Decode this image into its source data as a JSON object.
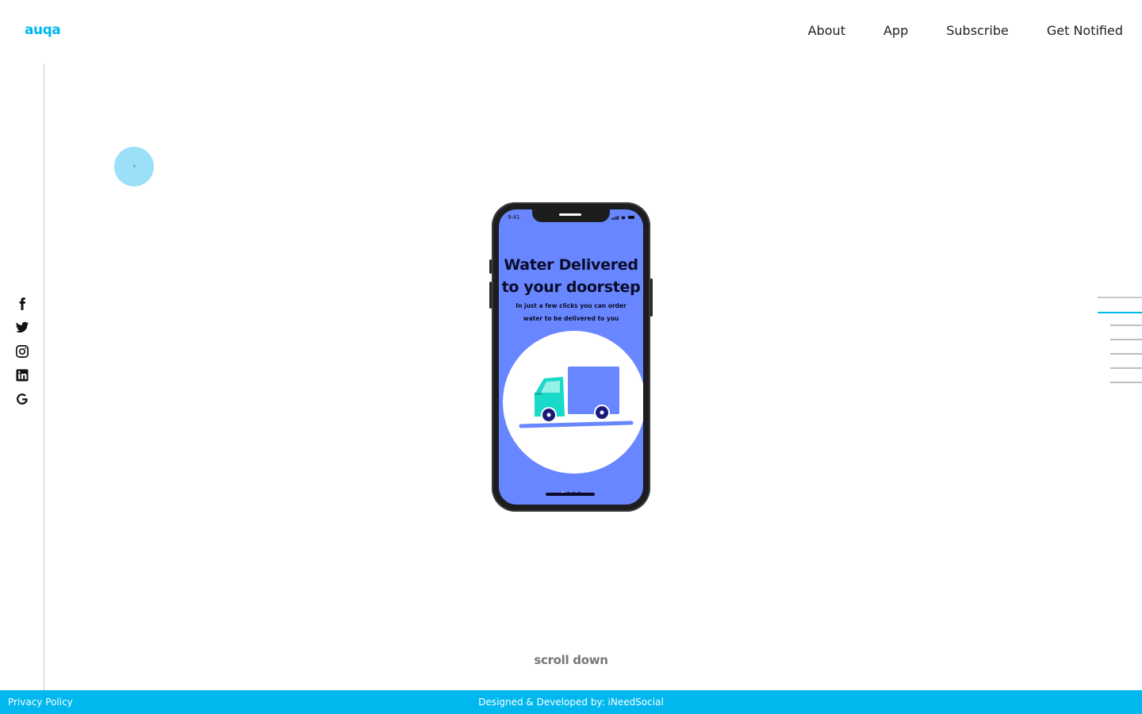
{
  "header": {
    "logo_text": "auqa",
    "nav": [
      "About",
      "App",
      "Subscribe",
      "Get Notified"
    ]
  },
  "social_icons": [
    "facebook-icon",
    "twitter-icon",
    "instagram-icon",
    "linkedin-icon",
    "google-icon"
  ],
  "phone": {
    "status_time": "9:41",
    "title_line1": "Water Delivered",
    "title_line2": "to your doorstep",
    "sub_line1": "In just a few clicks you can order",
    "sub_line2": "water to be delivered to you",
    "pager": {
      "total": 4,
      "active": 1
    }
  },
  "scroll_hint": "scroll down",
  "section_indicators": {
    "total": 7,
    "active": 2
  },
  "footer": {
    "privacy_label": "Privacy Policy",
    "credit": "Designed & Developed by: iNeedSocial"
  },
  "colors": {
    "brand": "#00b7ee",
    "phone_screen": "#6886ff",
    "truck_cab": "#19d9c8",
    "truck_box": "#6886ff",
    "cursor_circle": "#9be0f8"
  }
}
